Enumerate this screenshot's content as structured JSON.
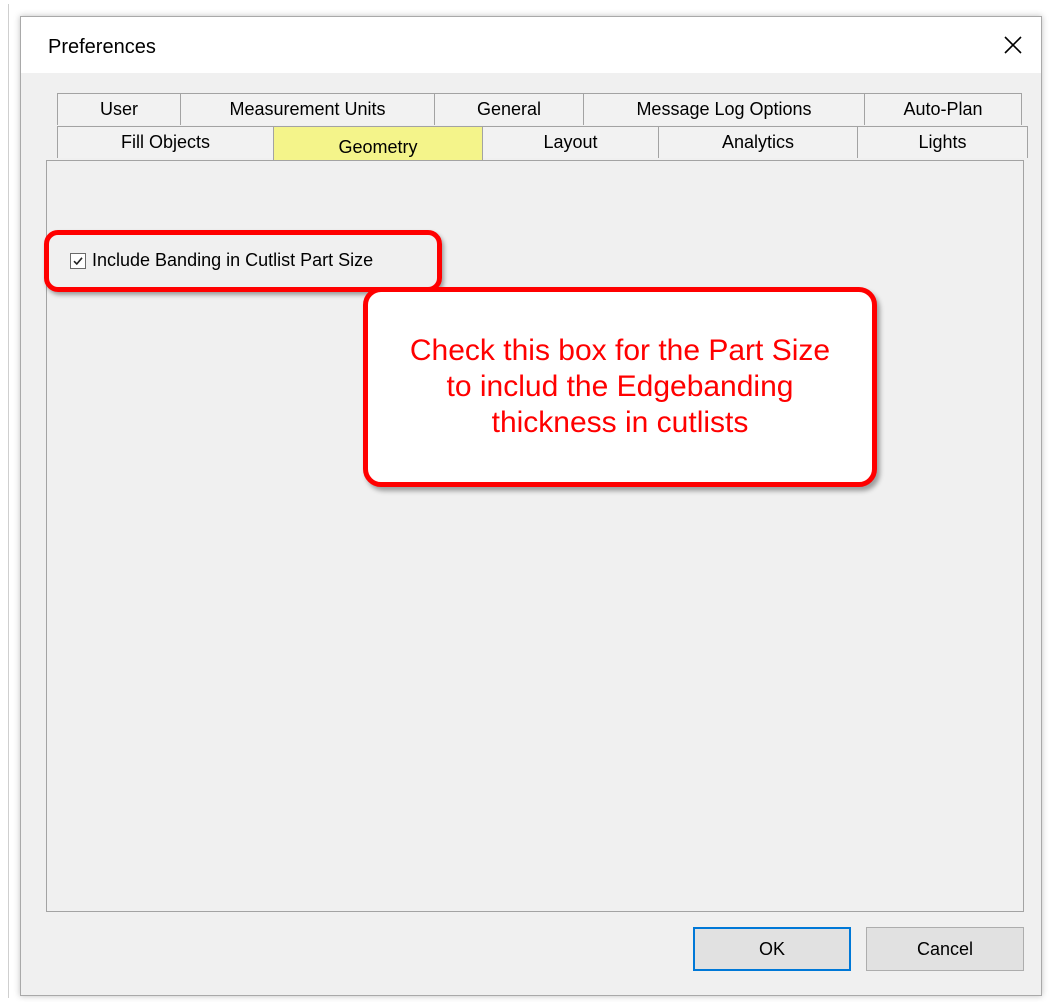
{
  "window": {
    "title": "Preferences"
  },
  "tabs": {
    "row1": [
      {
        "label": "User",
        "width": 124
      },
      {
        "label": "Measurement Units",
        "width": 255
      },
      {
        "label": "General",
        "width": 150
      },
      {
        "label": "Message Log Options",
        "width": 282
      },
      {
        "label": "Auto-Plan",
        "width": 158
      }
    ],
    "row2": [
      {
        "label": "Fill Objects",
        "width": 217
      },
      {
        "label": "Geometry",
        "width": 210,
        "active": true
      },
      {
        "label": "Layout",
        "width": 177
      },
      {
        "label": "Analytics",
        "width": 200
      },
      {
        "label": "Lights",
        "width": 171
      }
    ]
  },
  "geometry": {
    "include_banding_label": "Include Banding in Cutlist Part Size",
    "include_banding_checked": true
  },
  "annotation": {
    "callout_text": "Check this box for the Part Size to includ the Edgebanding thickness in cutlists",
    "color": "#ff0000"
  },
  "buttons": {
    "ok": "OK",
    "cancel": "Cancel"
  },
  "icons": {
    "close": "close-icon",
    "check": "checkmark-icon"
  }
}
